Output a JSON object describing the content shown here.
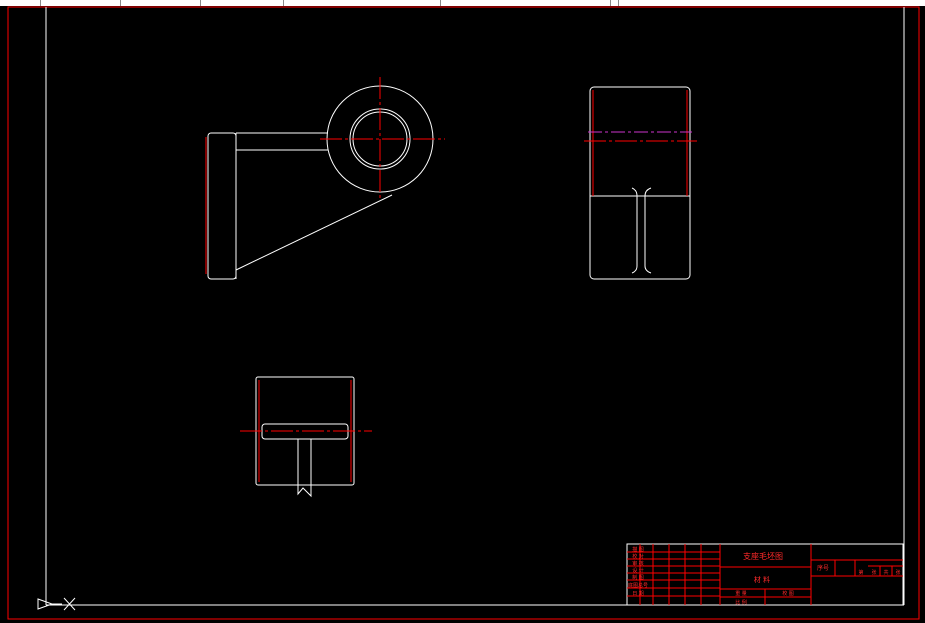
{
  "window": {
    "background": "#000000",
    "ruler_color": "#ffffff"
  },
  "colors": {
    "geometry": "#ffffff",
    "border": "#ff0000",
    "centerline": "#ff0000",
    "hidden_line": "#cc33cc",
    "title_text": "#ff2a2a"
  },
  "title_block": {
    "part_name": "支座毛坯图",
    "material_label": "材  料",
    "ratio_label": "比  例",
    "left_rows": [
      "描  图",
      "校  对",
      "审  核",
      "设  计",
      "制  图",
      "底图总号",
      "日  期"
    ],
    "bottom_cells": [
      "重  量",
      "校  图"
    ],
    "index_label": "序号",
    "sheet_cells": [
      "第",
      "张",
      "共",
      "张"
    ]
  },
  "ucs_icon": {
    "name": "ucs-axis-icon"
  }
}
